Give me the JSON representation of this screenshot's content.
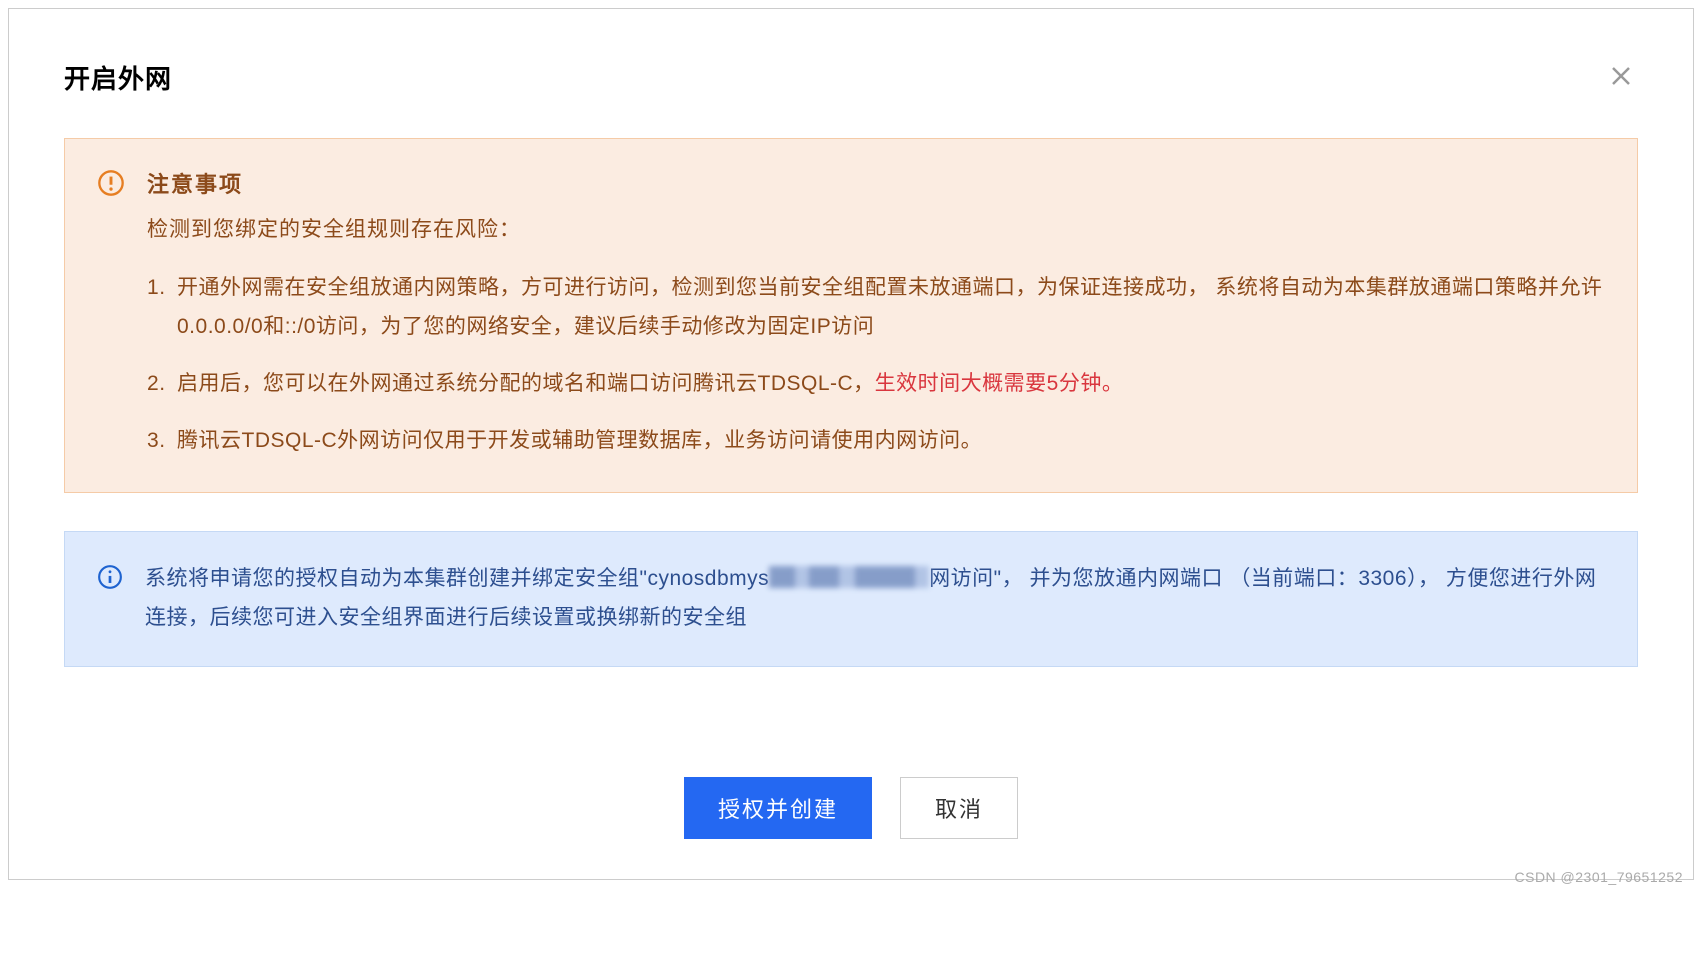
{
  "dialog": {
    "title": "开启外网"
  },
  "warning": {
    "heading": "注意事项",
    "subtitle": "检测到您绑定的安全组规则存在风险：",
    "item1": "开通外网需在安全组放通内网策略，方可进行访问，检测到您当前安全组配置未放通端口，为保证连接成功， 系统将自动为本集群放通端口策略并允许0.0.0.0/0和::/0访问，为了您的网络安全，建议后续手动修改为固定IP访问",
    "item2_prefix": "启用后，您可以在外网通过系统分配的域名和端口访问腾讯云TDSQL-C，",
    "item2_highlight": "生效时间大概需要5分钟。",
    "item3": "腾讯云TDSQL-C外网访问仅用于开发或辅助管理数据库，业务访问请使用内网访问。"
  },
  "info": {
    "line1_prefix": "系统将申请您的授权自动为本集群创建并绑定安全组\"cynosdbmys",
    "line1_suffix": "网访问\"， 并为您放通内网端口",
    "line2_prefix": "（当前端口：",
    "port": "3306",
    "line2_suffix": "）， 方便您进行外网连接，后续您可进入安全组界面进行后续设置或换绑新的安全组"
  },
  "buttons": {
    "confirm": "授权并创建",
    "cancel": "取消"
  },
  "watermark": "CSDN @2301_79651252"
}
